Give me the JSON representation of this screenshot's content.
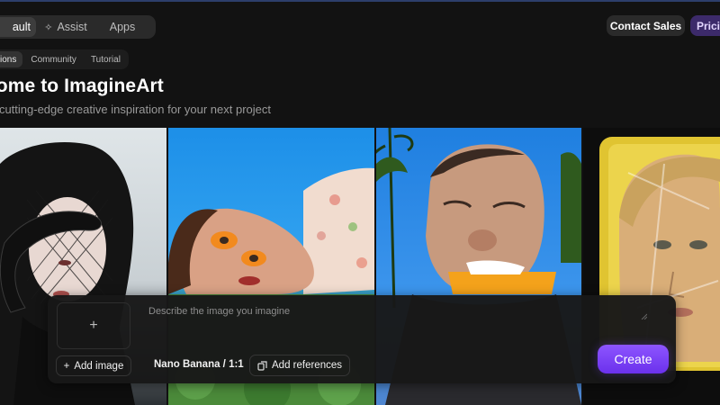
{
  "mode_switch": {
    "default_label": "ault",
    "assist_label": "Assist",
    "apps_label": "Apps"
  },
  "header": {
    "contact_sales": "Contact Sales",
    "pricing": "Pricir"
  },
  "subtabs": [
    "ions",
    "Community",
    "Tutorial"
  ],
  "hero": {
    "title": "come to ImagineArt",
    "subtitle": "r cutting-edge creative inspiration for your next project"
  },
  "gallery": {
    "images": [
      {
        "icon": "portrait-with-snake-image"
      },
      {
        "icon": "woman-with-orange-eyeshadow-image"
      },
      {
        "icon": "man-with-popsicle-image"
      },
      {
        "icon": "woman-in-plastic-wrap-image"
      }
    ]
  },
  "composer": {
    "add_plus": "+",
    "add_image": "Add image",
    "prompt_placeholder": "Describe the image you imagine",
    "model": "Nano Banana / 1:1",
    "add_references": "Add references",
    "create": "Create"
  },
  "colors": {
    "accent": "#7b41f6",
    "background": "#121212",
    "panel": "#181818"
  }
}
